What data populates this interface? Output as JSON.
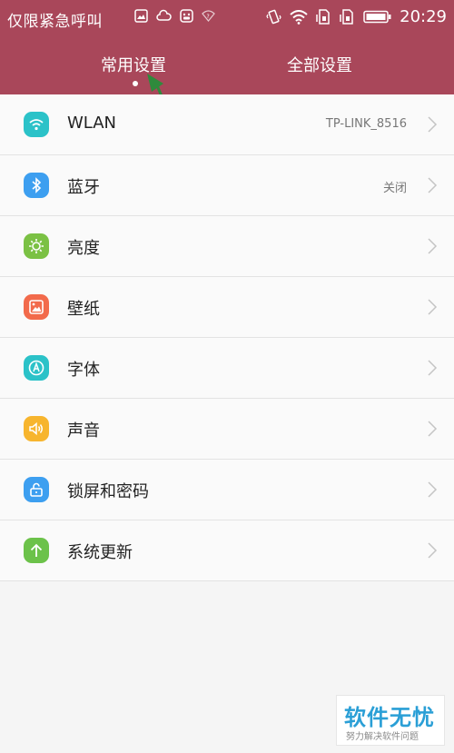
{
  "status_bar": {
    "carrier": "仅限紧急呼叫",
    "time": "20:29",
    "icons_left": [
      "image-icon",
      "cloud-icon",
      "android-icon",
      "wifi-question-icon"
    ],
    "icons_right": [
      "vibrate-icon",
      "wifi-icon",
      "sim-card-icon",
      "sim-card-icon",
      "battery-icon"
    ]
  },
  "tabs": [
    {
      "label": "常用设置",
      "active": true
    },
    {
      "label": "全部设置",
      "active": false
    }
  ],
  "settings": [
    {
      "label": "WLAN",
      "value": "TP-LINK_8516",
      "icon": "wifi-icon",
      "color": "#2bc2c8"
    },
    {
      "label": "蓝牙",
      "value": "关闭",
      "icon": "bluetooth-icon",
      "color": "#3d9ff0"
    },
    {
      "label": "亮度",
      "value": "",
      "icon": "sun-icon",
      "color": "#7bc144"
    },
    {
      "label": "壁纸",
      "value": "",
      "icon": "picture-icon",
      "color": "#f26a4b"
    },
    {
      "label": "字体",
      "value": "",
      "icon": "font-icon",
      "color": "#2bc2c8"
    },
    {
      "label": "声音",
      "value": "",
      "icon": "speaker-icon",
      "color": "#f7b52e"
    },
    {
      "label": "锁屏和密码",
      "value": "",
      "icon": "lock-icon",
      "color": "#3d9ff0"
    },
    {
      "label": "系统更新",
      "value": "",
      "icon": "arrow-up-icon",
      "color": "#6cc24a"
    }
  ],
  "watermark": {
    "title": "软件无忧",
    "subtitle": "努力解决软件问题"
  },
  "colors": {
    "header": "#a9475a",
    "annotation_arrow": "#2f8a3c"
  }
}
